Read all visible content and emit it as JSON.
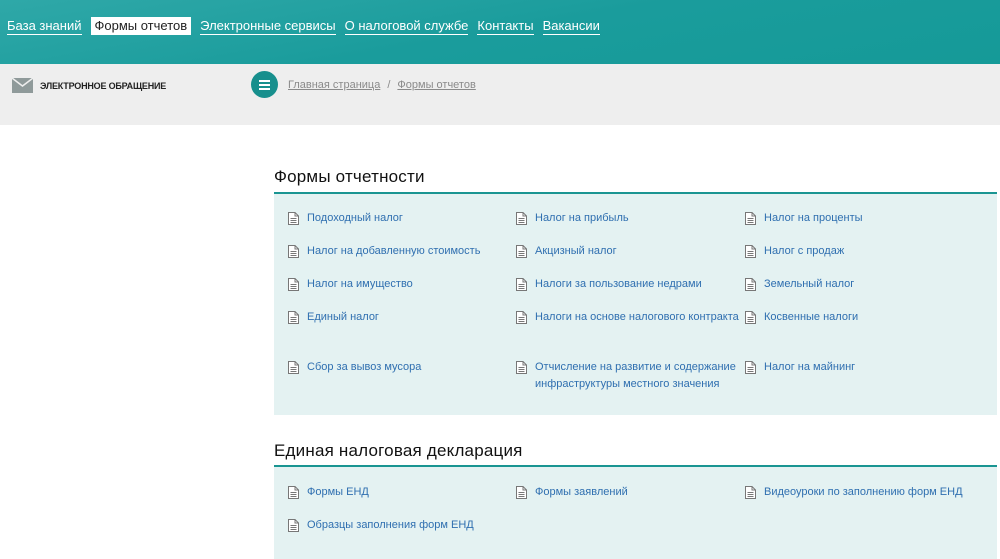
{
  "nav": [
    "База знаний",
    "Формы отчетов",
    "Электронные сервисы",
    "О налоговой службе",
    "Контакты",
    "Вакансии"
  ],
  "nav_active": 1,
  "appeal_label": "ЭЛЕКТРОННОЕ ОБРАЩЕНИЕ",
  "breadcrumb": [
    "Главная страница",
    "Формы отчетов"
  ],
  "breadcrumb_sep": "/",
  "sections": [
    {
      "title": "Формы отчетности",
      "items": [
        "Подоходный налог",
        "Налог на прибыль",
        "Налог на проценты",
        "Налог на добавленную стоимость",
        "Акцизный налог",
        "Налог с продаж",
        "Налог на имущество",
        "Налоги за пользование недрами",
        "Земельный налог",
        "Единый налог",
        "Налоги на основе налогового контракта",
        "Косвенные налоги",
        "Сбор за вывоз мусора",
        "Отчисление на развитие и содержание инфраструктуры местного значения",
        "Налог на майнинг"
      ]
    },
    {
      "title": "Единая налоговая декларация",
      "items": [
        "Формы ЕНД",
        "Формы заявлений",
        "Видеоуроки по заполнению форм ЕНД",
        "Образцы заполнения форм ЕНД"
      ]
    }
  ],
  "colors": {
    "accent": "#1a9592",
    "link": "#2f6fb0",
    "panel": "#e4f2f2"
  }
}
